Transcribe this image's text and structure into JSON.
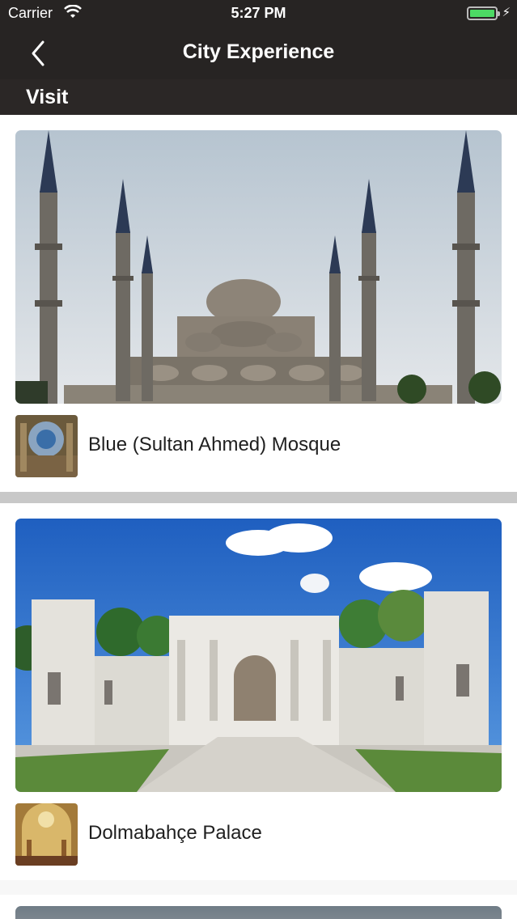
{
  "status_bar": {
    "carrier": "Carrier",
    "time": "5:27 PM"
  },
  "nav": {
    "title": "City Experience"
  },
  "section": {
    "title": "Visit"
  },
  "places": [
    {
      "name": "Blue (Sultan Ahmed) Mosque"
    },
    {
      "name": "Dolmabahçe Palace"
    }
  ],
  "colors": {
    "bar": "#272423",
    "battery": "#4cd964",
    "divider": "#c8c8c8"
  }
}
